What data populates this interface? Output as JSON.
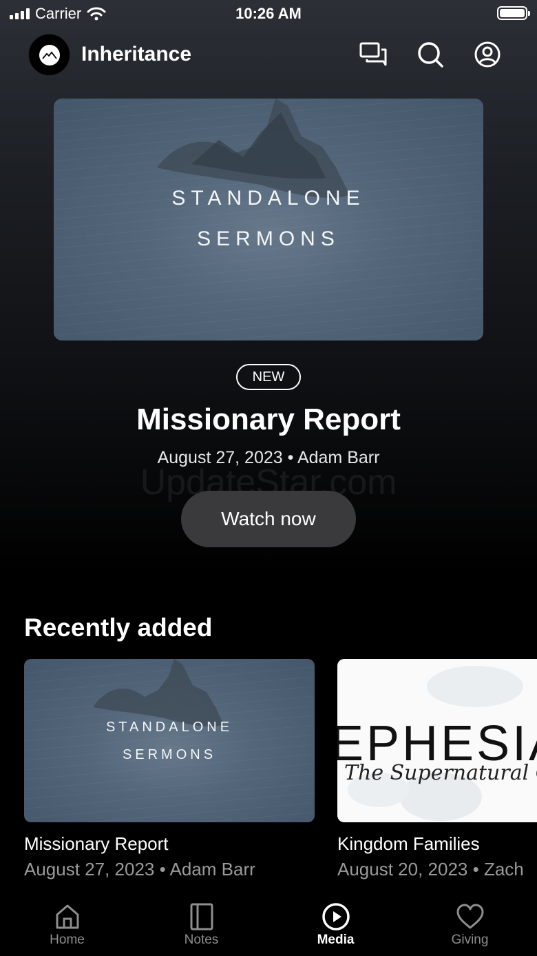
{
  "status": {
    "carrier": "Carrier",
    "time": "10:26 AM"
  },
  "header": {
    "title": "Inheritance"
  },
  "hero": {
    "image_line1": "STANDALONE",
    "image_line2": "SERMONS",
    "badge": "NEW",
    "title": "Missionary Report",
    "date": "August 27, 2023",
    "author": "Adam Barr",
    "watch_label": "Watch now",
    "watermark": "UpdateStar.com"
  },
  "recent": {
    "title": "Recently added",
    "items": [
      {
        "image_line1": "STANDALONE",
        "image_line2": "SERMONS",
        "title": "Missionary Report",
        "date": "August 27, 2023",
        "author": "Adam Barr"
      },
      {
        "image_line1": "EPHESIA",
        "image_line2": "The Supernatural C",
        "title": "Kingdom Families",
        "date": "August 20, 2023",
        "author": "Zach"
      }
    ]
  },
  "tabs": [
    {
      "label": "Home",
      "icon": "home-icon"
    },
    {
      "label": "Notes",
      "icon": "notes-icon"
    },
    {
      "label": "Media",
      "icon": "play-icon",
      "active": true
    },
    {
      "label": "Giving",
      "icon": "heart-icon"
    }
  ],
  "separator": "•"
}
